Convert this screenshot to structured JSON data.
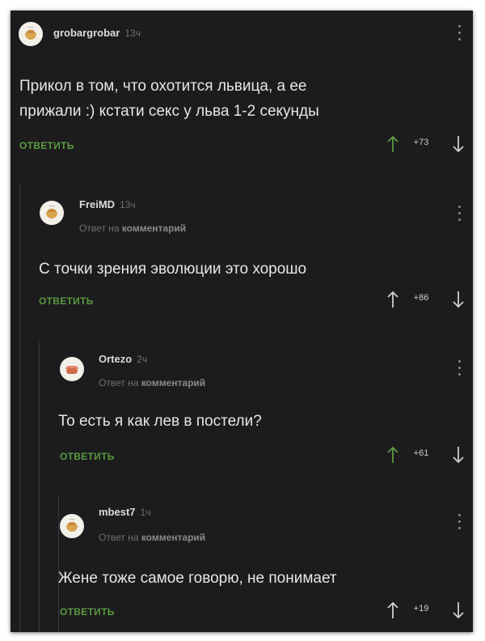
{
  "comments": [
    {
      "author": "grobargrobar",
      "time": "13ч",
      "reply_to": "",
      "text_lines": [
        "Прикол в том, что охотится львица, а ее",
        "прижали :) кстати секс у льва 1-2 секунды"
      ],
      "reply_label": "ОТВЕТИТЬ",
      "score": "+73",
      "upvoted": true
    },
    {
      "author": "FreiMD",
      "time": "13ч",
      "reply_to_prefix": "Ответ на",
      "reply_to_target": "комментарий",
      "text_lines": [
        "С точки зрения эволюции это хорошо"
      ],
      "reply_label": "ОТВЕТИТЬ",
      "score": "+86",
      "upvoted": false
    },
    {
      "author": "Ortezo",
      "time": "2ч",
      "reply_to_prefix": "Ответ на",
      "reply_to_target": "комментарий",
      "text_lines": [
        "То есть я как лев в постели?"
      ],
      "reply_label": "ОТВЕТИТЬ",
      "score": "+61",
      "upvoted": true
    },
    {
      "author": "mbest7",
      "time": "1ч",
      "reply_to_prefix": "Ответ на",
      "reply_to_target": "комментарий",
      "text_lines": [
        "Жене тоже самое говорю, не понимает"
      ],
      "reply_label": "ОТВЕТИТЬ",
      "score": "+19",
      "upvoted": false
    }
  ],
  "colors": {
    "background": "#1c1c1e",
    "reply_green": "#5a9a3f",
    "upvote_active": "#5a9a3f",
    "arrow_inactive": "#cfcfcf"
  },
  "icons": {
    "upvote": "arrow-up-icon",
    "downvote": "arrow-down-icon",
    "menu": "more-vertical-icon",
    "avatar": "user-avatar"
  }
}
